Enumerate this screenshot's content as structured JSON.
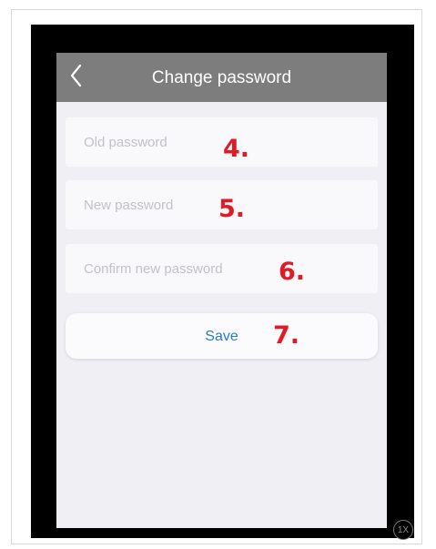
{
  "header": {
    "title": "Change password",
    "back_icon": "chevron-left-icon"
  },
  "form": {
    "old_password_placeholder": "Old password",
    "new_password_placeholder": "New password",
    "confirm_password_placeholder": "Confirm new password",
    "save_label": "Save"
  },
  "annotations": {
    "old_password": "4.",
    "new_password": "5.",
    "confirm_password": "6.",
    "save": "7."
  },
  "zoom_badge": "1X",
  "colors": {
    "nav_bar": "#7d7d7d",
    "screen_background": "#efeff4",
    "accent": "#2a7bc4",
    "annotation": "#e01b24"
  }
}
